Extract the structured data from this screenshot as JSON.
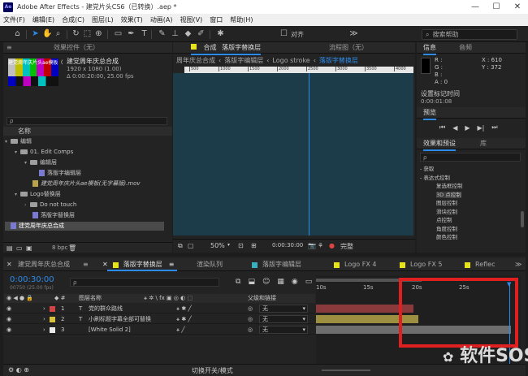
{
  "window": {
    "app_name": "Adobe After Effects",
    "title": "Adobe After Effects - 建党片头CS6（已转换）.aep *",
    "logo": "Ae"
  },
  "menu": [
    "文件(F)",
    "编辑(E)",
    "合成(C)",
    "图层(L)",
    "效果(T)",
    "动画(A)",
    "视图(V)",
    "窗口",
    "帮助(H)"
  ],
  "toolbar": {
    "align_label": "对齐",
    "search_help": "搜索帮助"
  },
  "project": {
    "tab_label": "项目",
    "effects_tab": "效果控件（无）",
    "menu_icon": "≡",
    "thumb_title": "建党周年庆片头ae模板（",
    "comp_name": "建党周年庆总合成",
    "comp_res": "1920 x 1080 (1.00)",
    "comp_dur": "Δ 0:00:20:00, 25.00 fps",
    "search_placeholder": "ρ",
    "col_name": "名称",
    "bpc": "8 bpc",
    "tree": [
      {
        "label": "编辑",
        "indent": 0,
        "type": "folder",
        "open": true
      },
      {
        "label": "01. Edit Comps",
        "indent": 1,
        "type": "folder",
        "open": true
      },
      {
        "label": "编辑层",
        "indent": 2,
        "type": "folder",
        "open": true
      },
      {
        "label": "落版字编辑层",
        "indent": 3,
        "type": "comp"
      },
      {
        "label": "建党周年庆片头ae模板(无字幕版).mov",
        "indent": 2,
        "type": "file"
      },
      {
        "label": "Logo替换层",
        "indent": 1,
        "type": "folder",
        "open": true
      },
      {
        "label": "Do not touch",
        "indent": 2,
        "type": "folder",
        "open": false
      },
      {
        "label": "落版字替换层",
        "indent": 2,
        "type": "comp"
      },
      {
        "label": "建党周年庆总合成",
        "indent": 0,
        "type": "comp",
        "selected": true
      }
    ]
  },
  "composition": {
    "tab_prefix": "合成",
    "tab_name": "落版字替换层",
    "flow_label": "流程图（无）",
    "breadcrumbs": [
      "周年庆总合成",
      "落版字编辑层",
      "Logo stroke",
      "落版字替换层"
    ],
    "ruler_ticks": [
      "500",
      "1000",
      "1500",
      "2000",
      "2500",
      "3000",
      "3500",
      "4000"
    ],
    "zoom": "50%",
    "timecode": "0:00:30:00",
    "quality": "完整"
  },
  "info": {
    "tab_info": "信息",
    "tab_audio": "音频",
    "r": "R :",
    "g": "G :",
    "b": "B :",
    "a": "A : 0",
    "x": "X : 610",
    "y": "Y : 372",
    "marker_label": "设置标记时间",
    "marker_time": "0:00:01:08"
  },
  "preview": {
    "tab_label": "预览"
  },
  "effects": {
    "tab_label": "效果和预设",
    "lib_tab": "库",
    "search_placeholder": "ρ",
    "items": [
      {
        "label": "- 获取",
        "indent": 0
      },
      {
        "label": "- 表达式控制",
        "indent": 0
      },
      {
        "label": "复选框控制",
        "indent": 2
      },
      {
        "label": "3D 点控制",
        "indent": 2,
        "highlight": true
      },
      {
        "label": "图层控制",
        "indent": 2
      },
      {
        "label": "滑块控制",
        "indent": 2
      },
      {
        "label": "点控制",
        "indent": 2
      },
      {
        "label": "角度控制",
        "indent": 2
      },
      {
        "label": "颜色控制",
        "indent": 2
      }
    ]
  },
  "timeline": {
    "tabs": [
      {
        "label": "建党周年庆总合成",
        "color": "#8b8b8b",
        "active": false
      },
      {
        "label": "落版字替换层",
        "color": "#e7e31b",
        "active": true
      },
      {
        "label": "渲染队列",
        "color": "",
        "active": false
      },
      {
        "label": "落版字编辑层",
        "color": "#3ab0bd",
        "active": false
      },
      {
        "label": "Logo FX 4",
        "color": "#e7e31b",
        "active": false
      },
      {
        "label": "Logo FX 5",
        "color": "#e7e31b",
        "active": false
      },
      {
        "label": "Reflec",
        "color": "#e7e31b",
        "active": false
      }
    ],
    "timecode": "0:00:30:00",
    "timecode_sub": "00750 (25.00 fps)",
    "search_placeholder": "ρ",
    "col_layer": "图层名称",
    "col_parent": "父级和链接",
    "toggle_label": "切换开关/模式",
    "time_ticks": [
      "10s",
      "15s",
      "20s",
      "25s"
    ],
    "layers": [
      {
        "num": "1",
        "type": "T",
        "name": "党的群众路线",
        "color": "#d14545",
        "parent": "无",
        "bar_color": "#8a3a3a"
      },
      {
        "num": "2",
        "type": "T",
        "name": "小刷标题字幕全部可替换",
        "color": "#d8c23a",
        "parent": "无",
        "bar_color": "#9c9040"
      },
      {
        "num": "3",
        "type": "",
        "name": "[White Solid 2]",
        "color": "#eaeaea",
        "parent": "无",
        "bar_color": "#6e6e6e"
      }
    ]
  },
  "watermark": {
    "text": "软件SOS"
  },
  "colors": {
    "accent": "#2d8ceb",
    "canvas": "#1c3c4a",
    "highlight_box": "#e02020"
  }
}
